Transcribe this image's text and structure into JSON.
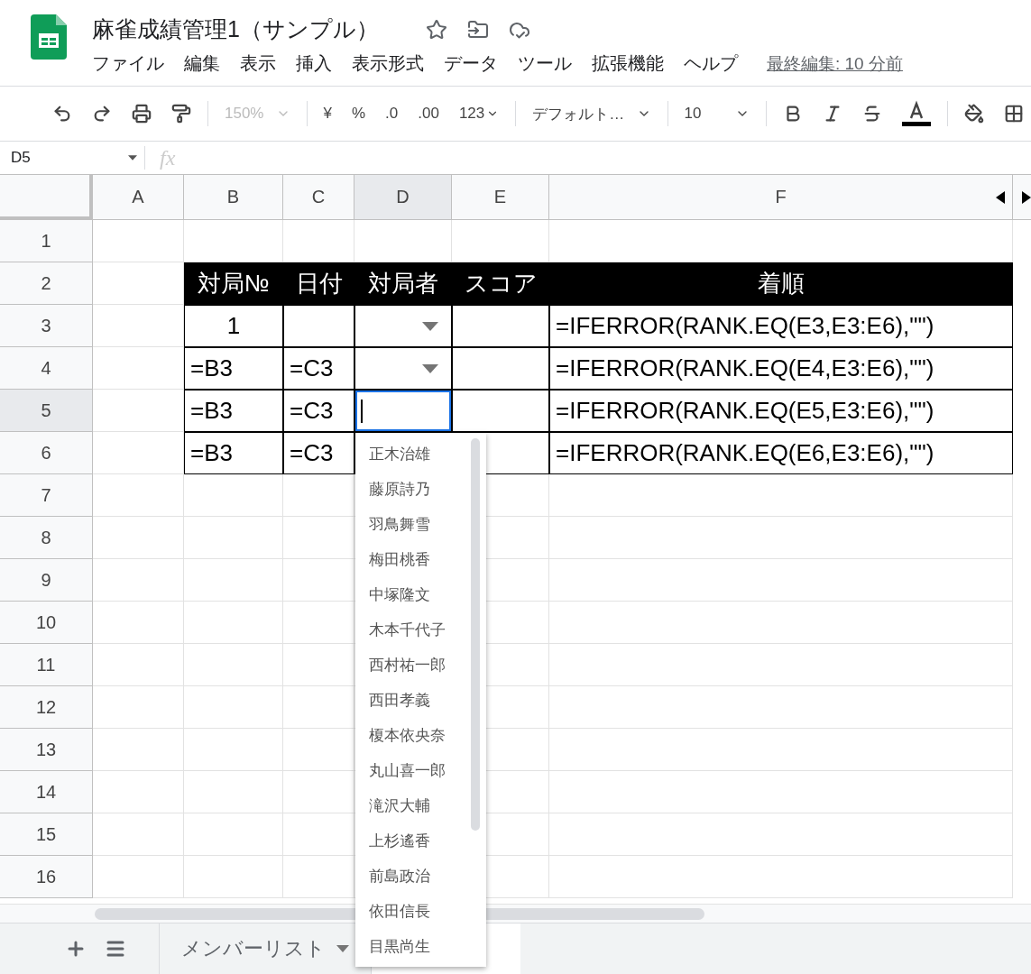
{
  "document": {
    "title": "麻雀成績管理1（サンプル）",
    "last_edit": "最終編集: 10 分前"
  },
  "menu": [
    "ファイル",
    "編集",
    "表示",
    "挿入",
    "表示形式",
    "データ",
    "ツール",
    "拡張機能",
    "ヘルプ"
  ],
  "toolbar": {
    "zoom": {
      "value": "150%",
      "disabled": true
    },
    "currency": "¥",
    "percent": "%",
    "decrease_decimal": ".0",
    "increase_decimal": ".00",
    "number_format": "123",
    "font": "デフォルト…",
    "font_size": "10"
  },
  "formula_bar": {
    "cell_reference": "D5",
    "function_label": "fx"
  },
  "columns": [
    {
      "label": "A",
      "selected": false
    },
    {
      "label": "B",
      "selected": false
    },
    {
      "label": "C",
      "selected": false
    },
    {
      "label": "D",
      "selected": true
    },
    {
      "label": "E",
      "selected": false
    },
    {
      "label": "F",
      "selected": false
    }
  ],
  "rows": [
    {
      "number": "1",
      "selected": false,
      "cells": [
        {
          "kind": "blank"
        },
        {
          "kind": "blank"
        },
        {
          "kind": "blank"
        },
        {
          "kind": "blank"
        },
        {
          "kind": "blank"
        },
        {
          "kind": "blank"
        }
      ]
    },
    {
      "number": "2",
      "selected": false,
      "cells": [
        {
          "kind": "blank"
        },
        {
          "kind": "header",
          "text": "対局№"
        },
        {
          "kind": "header",
          "text": "日付"
        },
        {
          "kind": "header",
          "text": "対局者"
        },
        {
          "kind": "header",
          "text": "スコア"
        },
        {
          "kind": "header",
          "text": "着順"
        }
      ]
    },
    {
      "number": "3",
      "selected": false,
      "cells": [
        {
          "kind": "blank"
        },
        {
          "kind": "number",
          "text": "1"
        },
        {
          "kind": "cell"
        },
        {
          "kind": "dropdown"
        },
        {
          "kind": "cell"
        },
        {
          "kind": "cell",
          "text": "=IFERROR(RANK.EQ(E3,E3:E6),\"\")"
        }
      ]
    },
    {
      "number": "4",
      "selected": false,
      "cells": [
        {
          "kind": "blank"
        },
        {
          "kind": "cell",
          "text": "=B3"
        },
        {
          "kind": "cell",
          "text": "=C3"
        },
        {
          "kind": "dropdown"
        },
        {
          "kind": "cell"
        },
        {
          "kind": "cell",
          "text": "=IFERROR(RANK.EQ(E4,E3:E6),\"\")"
        }
      ]
    },
    {
      "number": "5",
      "selected": true,
      "cells": [
        {
          "kind": "blank"
        },
        {
          "kind": "cell",
          "text": "=B3"
        },
        {
          "kind": "cell",
          "text": "=C3"
        },
        {
          "kind": "editing"
        },
        {
          "kind": "cell"
        },
        {
          "kind": "cell",
          "text": "=IFERROR(RANK.EQ(E5,E3:E6),\"\")"
        }
      ]
    },
    {
      "number": "6",
      "selected": false,
      "cells": [
        {
          "kind": "blank"
        },
        {
          "kind": "cell",
          "text": "=B3"
        },
        {
          "kind": "cell",
          "text": "=C3"
        },
        {
          "kind": "cell"
        },
        {
          "kind": "cell"
        },
        {
          "kind": "cell",
          "text": "=IFERROR(RANK.EQ(E6,E3:E6),\"\")"
        }
      ]
    },
    {
      "number": "7",
      "selected": false
    },
    {
      "number": "8",
      "selected": false
    },
    {
      "number": "9",
      "selected": false
    },
    {
      "number": "10",
      "selected": false
    },
    {
      "number": "11",
      "selected": false
    },
    {
      "number": "12",
      "selected": false
    },
    {
      "number": "13",
      "selected": false
    },
    {
      "number": "14",
      "selected": false
    },
    {
      "number": "15",
      "selected": false
    },
    {
      "number": "16",
      "selected": false
    }
  ],
  "dropdown_options": [
    "正木治雄",
    "藤原詩乃",
    "羽鳥舞雪",
    "梅田桃香",
    "中塚隆文",
    "木本千代子",
    "西村祐一郎",
    "西田孝義",
    "榎本依央奈",
    "丸山喜一郎",
    "滝沢大輔",
    "上杉遙香",
    "前島政治",
    "依田信長",
    "目黒尚生"
  ],
  "sheets": [
    {
      "name": "メンバーリスト",
      "selected": false
    },
    {
      "selected": true
    }
  ]
}
